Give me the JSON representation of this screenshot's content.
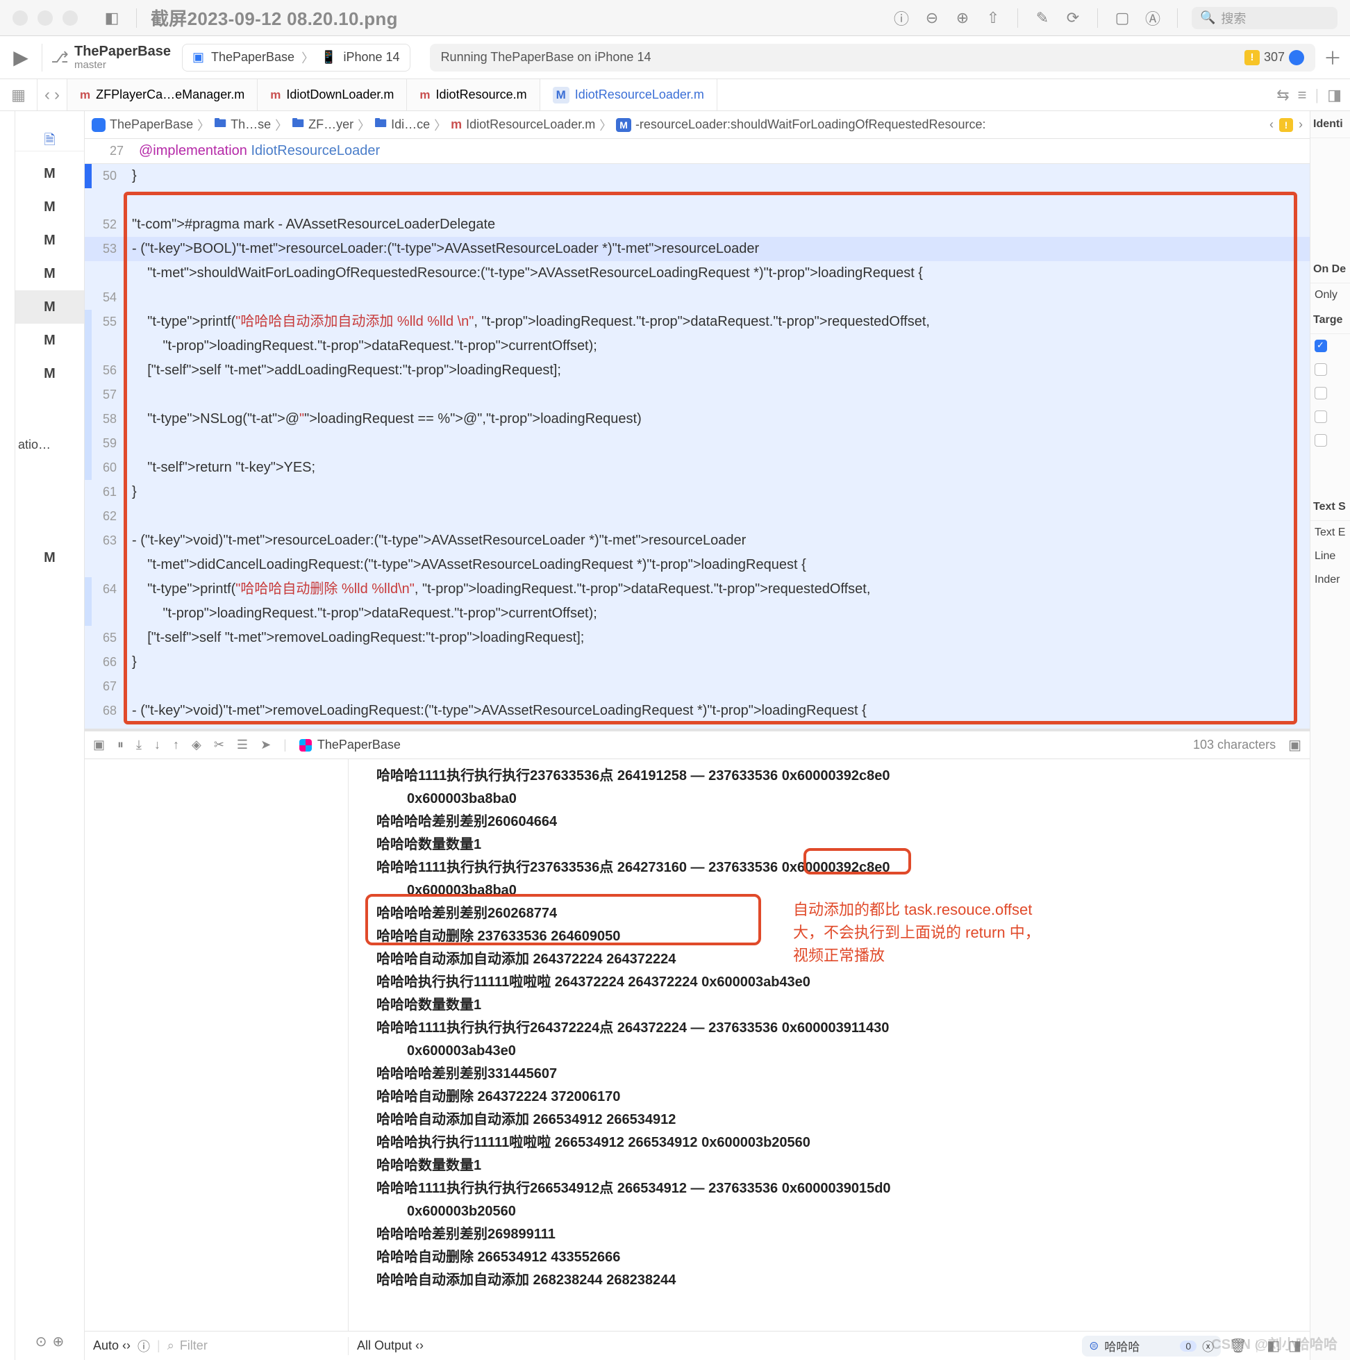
{
  "window": {
    "title": "截屏2023-09-12 08.20.10.png",
    "search_placeholder": "搜索"
  },
  "xcode_toolbar": {
    "project_name": "ThePaperBase",
    "branch": "master",
    "scheme_app": "ThePaperBase",
    "scheme_device": "iPhone 14",
    "status_text": "Running ThePaperBase on iPhone 14",
    "warning_count": "307"
  },
  "tabs": [
    {
      "label": "ZFPlayerCa…eManager.m",
      "kind": "m",
      "active": false
    },
    {
      "label": "IdiotDownLoader.m",
      "kind": "m",
      "active": false
    },
    {
      "label": "IdiotResource.m",
      "kind": "m",
      "active": false
    },
    {
      "label": "IdiotResourceLoader.m",
      "kind": "M",
      "active": true
    }
  ],
  "breadcrumbs": {
    "items": [
      "ThePaperBase",
      "Th…se",
      "ZF…yer",
      "Idi…ce",
      "IdiotResourceLoader.m",
      "-resourceLoader:shouldWaitForLoadingOfRequestedResource:"
    ]
  },
  "left_sidebar": {
    "items": [
      "M",
      "M",
      "M",
      "M",
      "M",
      "M",
      "M"
    ],
    "selected_index": 4,
    "extra_label": "atio…",
    "bottom_label": "M"
  },
  "editor": {
    "sticky": {
      "num": "27",
      "text": "@implementation IdiotResourceLoader"
    },
    "lines": [
      {
        "num": "50",
        "bar": "blue",
        "raw": "}"
      },
      {
        "num": "",
        "bar": "",
        "raw": ""
      },
      {
        "num": "52",
        "bar": "",
        "raw": "#pragma mark - AVAssetResourceLoaderDelegate"
      },
      {
        "num": "53",
        "bar": "",
        "raw": "- (BOOL)resourceLoader:(AVAssetResourceLoader *)resourceLoader",
        "cursor": true
      },
      {
        "num": "",
        "bar": "",
        "raw": "    shouldWaitForLoadingOfRequestedResource:(AVAssetResourceLoadingRequest *)loadingRequest {"
      },
      {
        "num": "54",
        "bar": "",
        "raw": "    "
      },
      {
        "num": "55",
        "bar": "lt",
        "raw": "    printf(\"哈哈哈自动添加自动添加 %lld %lld \\n\", loadingRequest.dataRequest.requestedOffset,"
      },
      {
        "num": "",
        "bar": "lt",
        "raw": "        loadingRequest.dataRequest.currentOffset);"
      },
      {
        "num": "56",
        "bar": "lt",
        "raw": "    [self addLoadingRequest:loadingRequest];"
      },
      {
        "num": "57",
        "bar": "lt",
        "raw": "    "
      },
      {
        "num": "58",
        "bar": "lt",
        "raw": "    NSLog(@\"loadingRequest == %@\",loadingRequest)"
      },
      {
        "num": "59",
        "bar": "lt",
        "raw": "    "
      },
      {
        "num": "60",
        "bar": "lt",
        "raw": "    return YES;"
      },
      {
        "num": "61",
        "bar": "",
        "raw": "}"
      },
      {
        "num": "62",
        "bar": "",
        "raw": ""
      },
      {
        "num": "63",
        "bar": "",
        "raw": "- (void)resourceLoader:(AVAssetResourceLoader *)resourceLoader"
      },
      {
        "num": "",
        "bar": "",
        "raw": "    didCancelLoadingRequest:(AVAssetResourceLoadingRequest *)loadingRequest {"
      },
      {
        "num": "64",
        "bar": "lt",
        "raw": "    printf(\"哈哈哈自动删除 %lld %lld\\n\", loadingRequest.dataRequest.requestedOffset,"
      },
      {
        "num": "",
        "bar": "lt",
        "raw": "        loadingRequest.dataRequest.currentOffset);"
      },
      {
        "num": "65",
        "bar": "",
        "raw": "    [self removeLoadingRequest:loadingRequest];"
      },
      {
        "num": "66",
        "bar": "",
        "raw": "}"
      },
      {
        "num": "67",
        "bar": "",
        "raw": ""
      },
      {
        "num": "68",
        "bar": "",
        "raw": "- (void)removeLoadingRequest:(AVAssetResourceLoadingRequest *)loadingRequest {"
      }
    ]
  },
  "debug_bar": {
    "project": "ThePaperBase",
    "chars": "103 characters"
  },
  "console": {
    "lines": [
      "哈哈哈1111执行执行执行237633536点 264191258 — 237633536 0x60000392c8e0",
      "    0x600003ba8ba0",
      "哈哈哈哈差别差别260604664",
      "哈哈哈数量数量1",
      "哈哈哈1111执行执行执行237633536点 264273160 — 237633536 0x60000392c8e0",
      "    0x600003ba8ba0",
      "哈哈哈哈差别差别260268774",
      "哈哈哈自动删除 237633536 264609050",
      "哈哈哈自动添加自动添加 264372224 264372224",
      "哈哈哈执行执行11111啦啦啦 264372224 264372224 0x600003ab43e0",
      "哈哈哈数量数量1",
      "哈哈哈1111执行执行执行264372224点 264372224 — 237633536 0x600003911430",
      "    0x600003ab43e0",
      "哈哈哈哈差别差别331445607",
      "哈哈哈自动删除 264372224 372006170",
      "哈哈哈自动添加自动添加 266534912 266534912",
      "哈哈哈执行执行11111啦啦啦 266534912 266534912 0x600003b20560",
      "哈哈哈数量数量1",
      "哈哈哈1111执行执行执行266534912点 266534912 — 237633536 0x6000039015d0",
      "    0x600003b20560",
      "哈哈哈哈差别差别269899111",
      "哈哈哈自动删除 266534912 433552666",
      "哈哈哈自动添加自动添加 268238244 268238244"
    ],
    "annotation_lines": [
      "自动添加的都比 task.resouce.offset",
      "大，不会执行到上面说的 return 中，",
      "视频正常播放"
    ]
  },
  "bottom_bar": {
    "left_mode": "Auto ‹›",
    "filter_placeholder": "Filter",
    "right_mode": "All Output ‹›",
    "filter_value": "哈哈哈",
    "filter_count": "0"
  },
  "inspector": {
    "section1": "Identi",
    "section2": "On De",
    "ondemand_value": "Only",
    "section3": "Targe",
    "section4": "Text S",
    "text_rows": [
      "Text E",
      "Line",
      "Inder"
    ]
  },
  "watermark": "CSDN @刘小哈哈哈"
}
